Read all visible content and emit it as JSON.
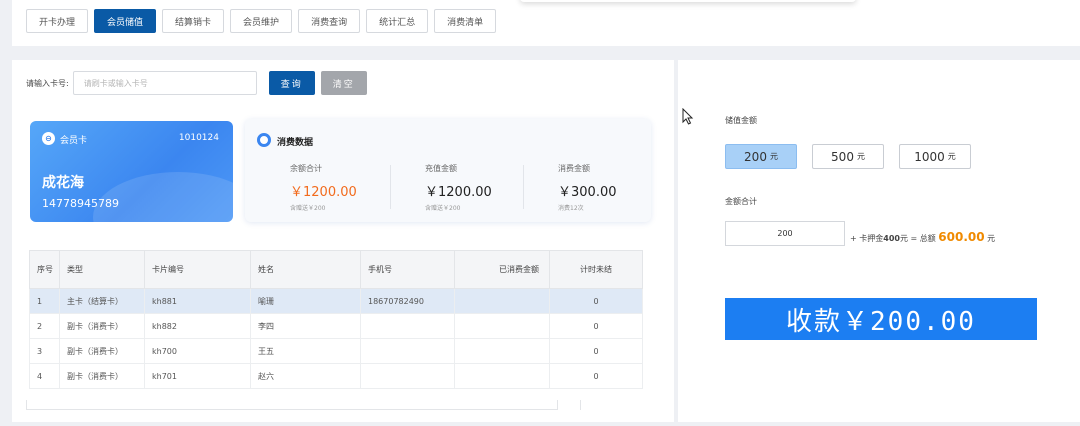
{
  "tabs": [
    {
      "label": "开卡办理",
      "active": false
    },
    {
      "label": "会员储值",
      "active": true
    },
    {
      "label": "结算销卡",
      "active": false
    },
    {
      "label": "会员维护",
      "active": false
    },
    {
      "label": "消费查询",
      "active": false
    },
    {
      "label": "统计汇总",
      "active": false
    },
    {
      "label": "消费清单",
      "active": false
    }
  ],
  "search": {
    "label": "请输入卡号:",
    "placeholder": "请刷卡或输入卡号",
    "query_label": "查询",
    "clear_label": "清空"
  },
  "card": {
    "icon": "card-icon",
    "type": "会员卡",
    "number": "1010124",
    "name": "成花海",
    "phone": "14778945789"
  },
  "stats": {
    "title": "消费数据",
    "items": [
      {
        "label": "余额合计",
        "value": "￥1200.00",
        "sub": "含赠送￥200",
        "highlight": true
      },
      {
        "label": "充值金额",
        "value": "￥1200.00",
        "sub": "含赠送￥200",
        "highlight": false
      },
      {
        "label": "消费金额",
        "value": "￥300.00",
        "sub": "消费12次",
        "highlight": false
      }
    ]
  },
  "table": {
    "headers": [
      "序号",
      "类型",
      "卡片编号",
      "姓名",
      "手机号",
      "已消费金额",
      "计时未结"
    ],
    "rows": [
      {
        "no": "1",
        "type": "主卡（结算卡）",
        "card": "kh881",
        "name": "喻珊",
        "phone": "18670782490",
        "spent": "",
        "pending": "0",
        "selected": true
      },
      {
        "no": "2",
        "type": "副卡（消费卡）",
        "card": "kh882",
        "name": "李四",
        "phone": "",
        "spent": "",
        "pending": "0",
        "selected": false
      },
      {
        "no": "3",
        "type": "副卡（消费卡）",
        "card": "kh700",
        "name": "王五",
        "phone": "",
        "spent": "",
        "pending": "0",
        "selected": false
      },
      {
        "no": "4",
        "type": "副卡（消费卡）",
        "card": "kh701",
        "name": "赵六",
        "phone": "",
        "spent": "",
        "pending": "0",
        "selected": false
      }
    ]
  },
  "recharge": {
    "amount_label": "储值金额",
    "options": [
      {
        "value": "200",
        "unit": "元",
        "active": true
      },
      {
        "value": "500",
        "unit": "元",
        "active": false
      },
      {
        "value": "1000",
        "unit": "元",
        "active": false
      }
    ],
    "total_label": "金额合计",
    "total_value": "200",
    "deposit_prefix": "+ 卡押金",
    "deposit_value": "400",
    "deposit_mid": "元 = 总额",
    "grand_total": "600.00",
    "grand_unit": "元",
    "pay_label": "收款￥200.00"
  },
  "colors": {
    "primary": "#0a5aa6",
    "accent": "#1c7ef2",
    "orange": "#f26b1d"
  }
}
